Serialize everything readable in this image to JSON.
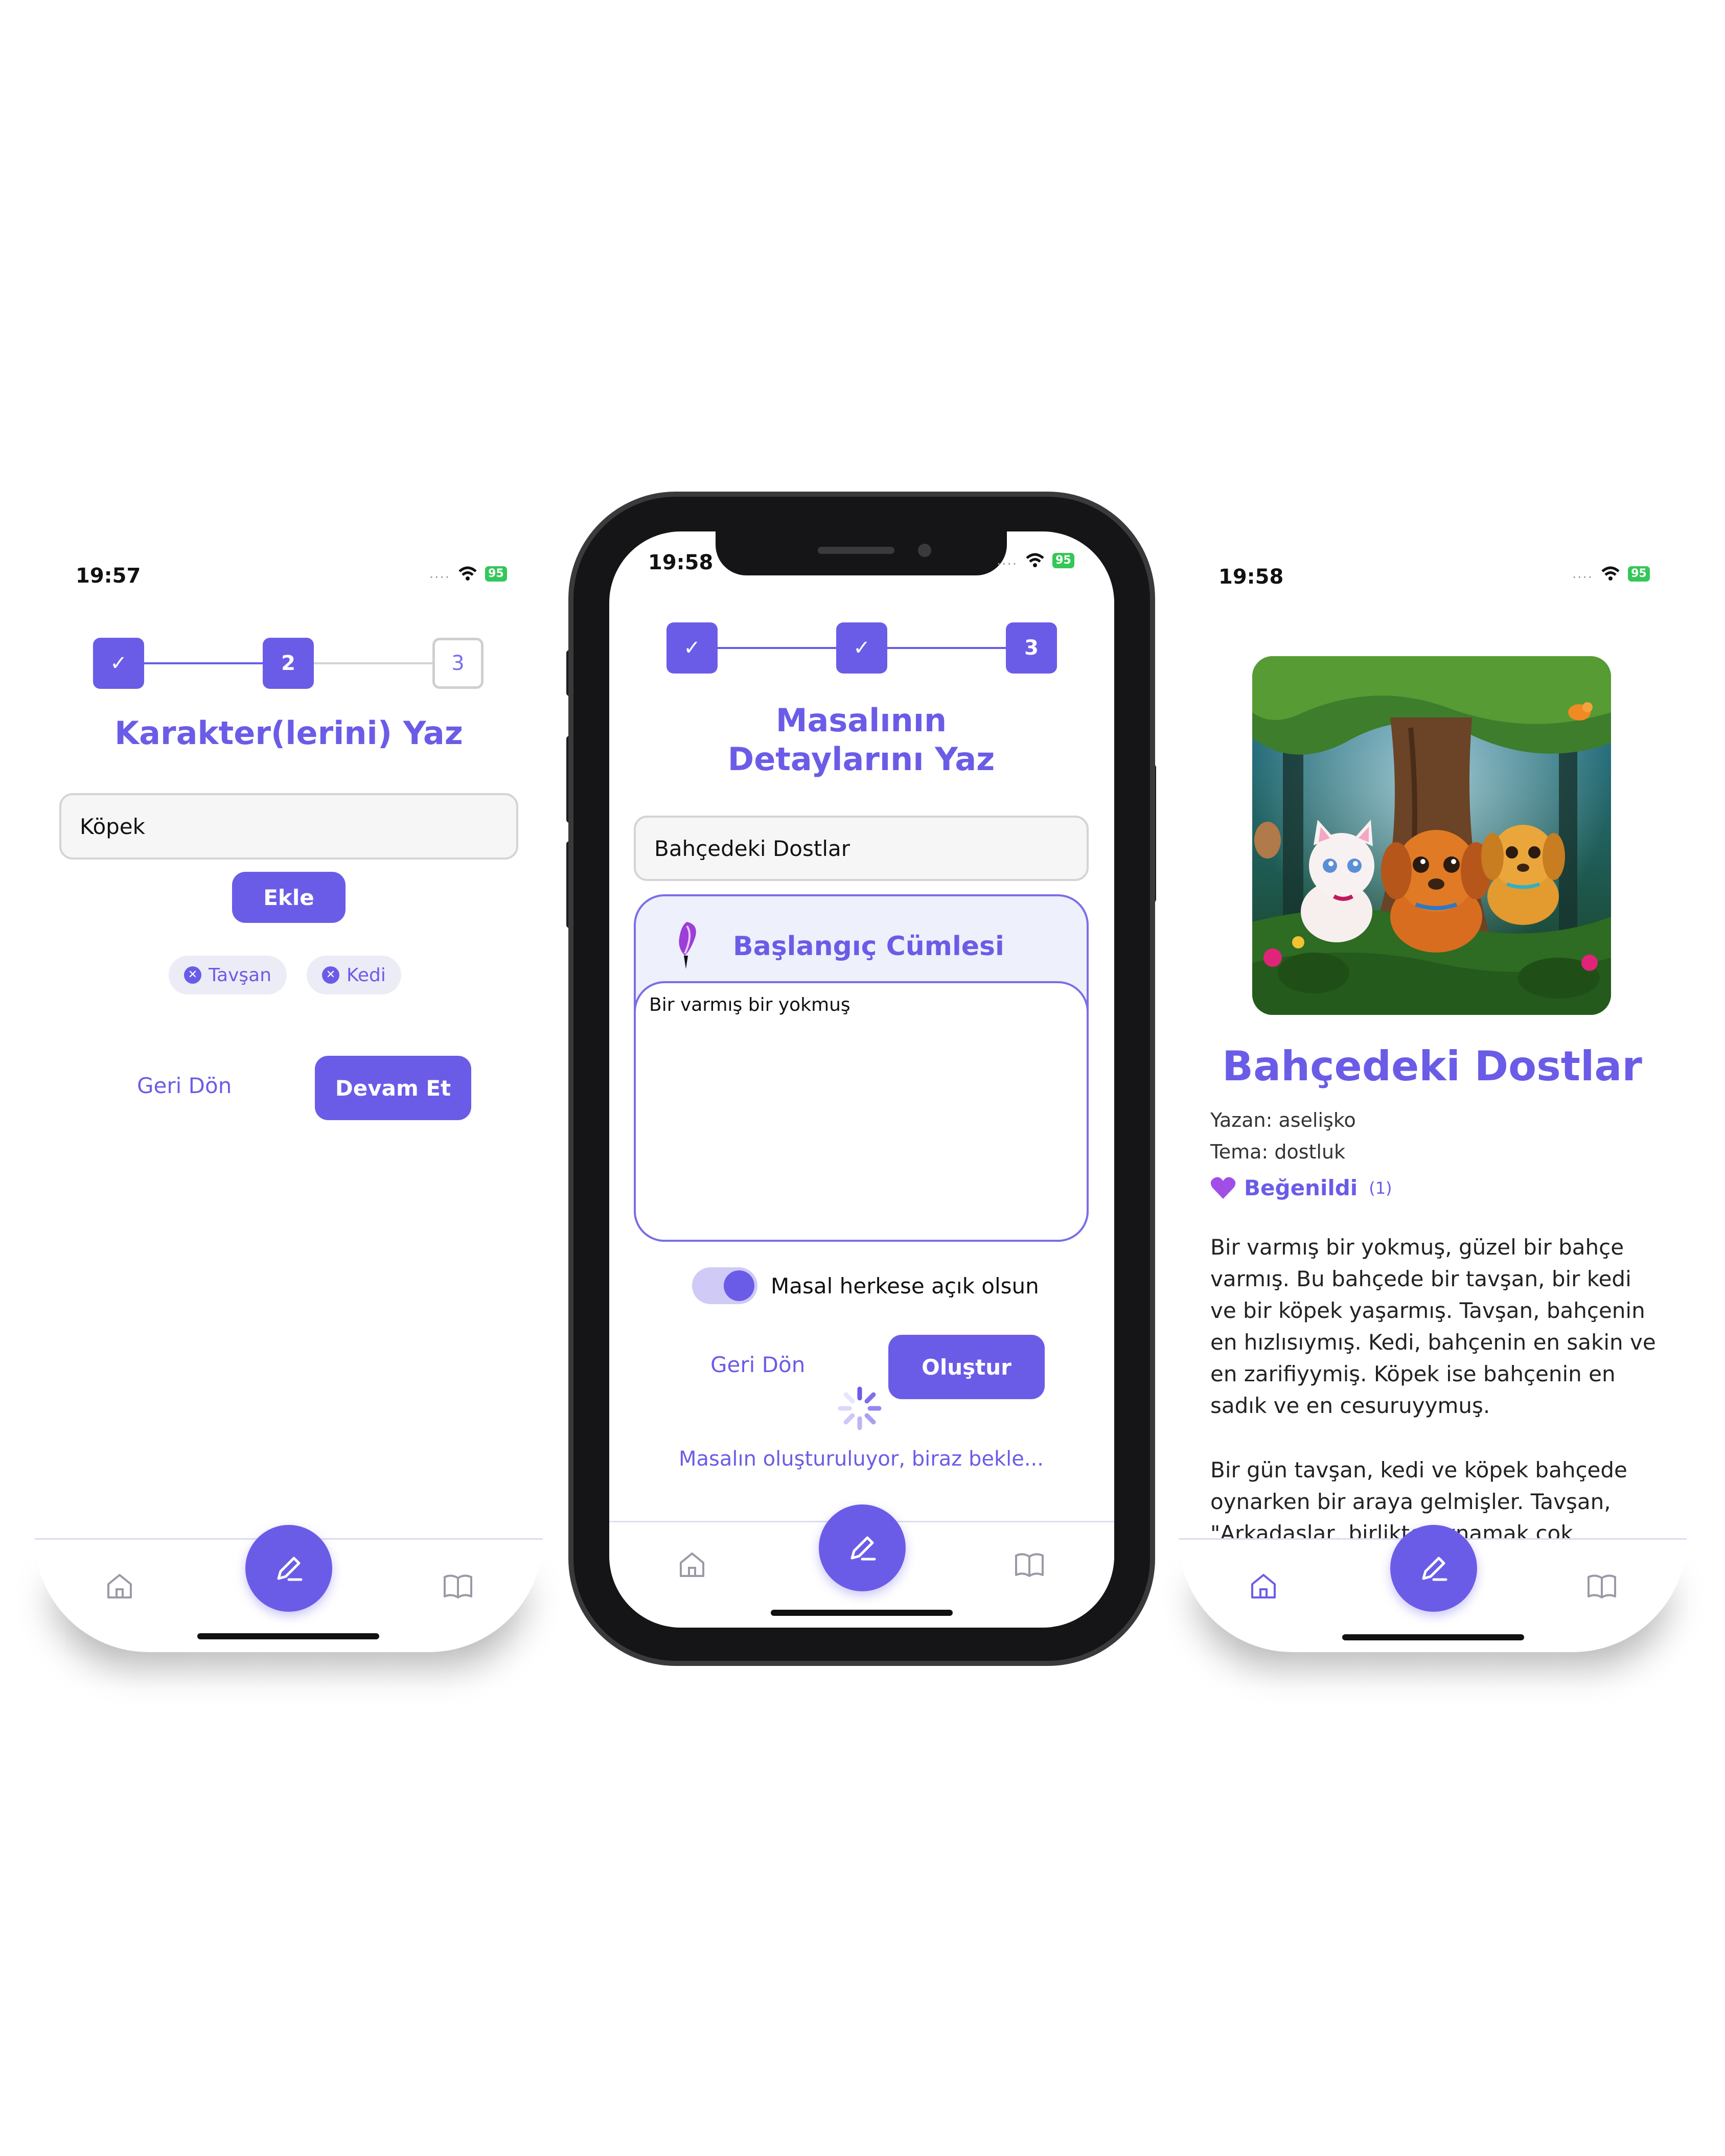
{
  "colors": {
    "accent": "#6b5ce7",
    "battery": "#34c759"
  },
  "screen_left": {
    "status": {
      "time": "19:57",
      "battery": "95"
    },
    "stepper": {
      "step1": "✓",
      "step2": "2",
      "step3": "3"
    },
    "title": "Karakter(lerini) Yaz",
    "character_input": {
      "value": "Köpek"
    },
    "add_button": "Ekle",
    "chips": [
      "Tavşan",
      "Kedi"
    ],
    "back_label": "Geri Dön",
    "continue_label": "Devam Et",
    "tabbar": {
      "icons": [
        "home-icon",
        "pencil-icon",
        "book-icon"
      ]
    }
  },
  "screen_middle": {
    "status": {
      "time": "19:58",
      "battery": "95"
    },
    "stepper": {
      "step1": "✓",
      "step2": "✓",
      "step3": "3"
    },
    "title_line1": "Masalının",
    "title_line2": "Detaylarını Yaz",
    "story_title_input": {
      "value": "Bahçedeki Dostlar"
    },
    "opening_section": {
      "heading": "Başlangıç Cümlesi",
      "text": "Bir varmış bir yokmuş"
    },
    "public_toggle": {
      "label": "Masal herkese açık olsun",
      "on": true
    },
    "back_label": "Geri Dön",
    "create_label": "Oluştur",
    "loading_text": "Masalın oluşturuluyor, biraz bekle..."
  },
  "screen_right": {
    "status": {
      "time": "19:58",
      "battery": "95"
    },
    "story_title": "Bahçedeki Dostlar",
    "author": "Yazan: aselişko",
    "theme": "Tema: dostluk",
    "liked_label": "Beğenildi",
    "like_count": "(1)",
    "paragraph1": "Bir varmış bir yokmuş, güzel bir bahçe varmış. Bu bahçede bir tavşan, bir kedi ve bir köpek yaşarmış. Tavşan, bahçenin en hızlısıymış. Kedi, bahçenin en sakin ve en zarifiyymiş. Köpek ise bahçenin en sadık ve en cesuruyymuş.",
    "paragraph2": "Bir gün tavşan, kedi ve köpek bahçede oynarken bir araya gelmişler. Tavşan, \"Arkadaşlar, birlikte oynamak çok"
  }
}
